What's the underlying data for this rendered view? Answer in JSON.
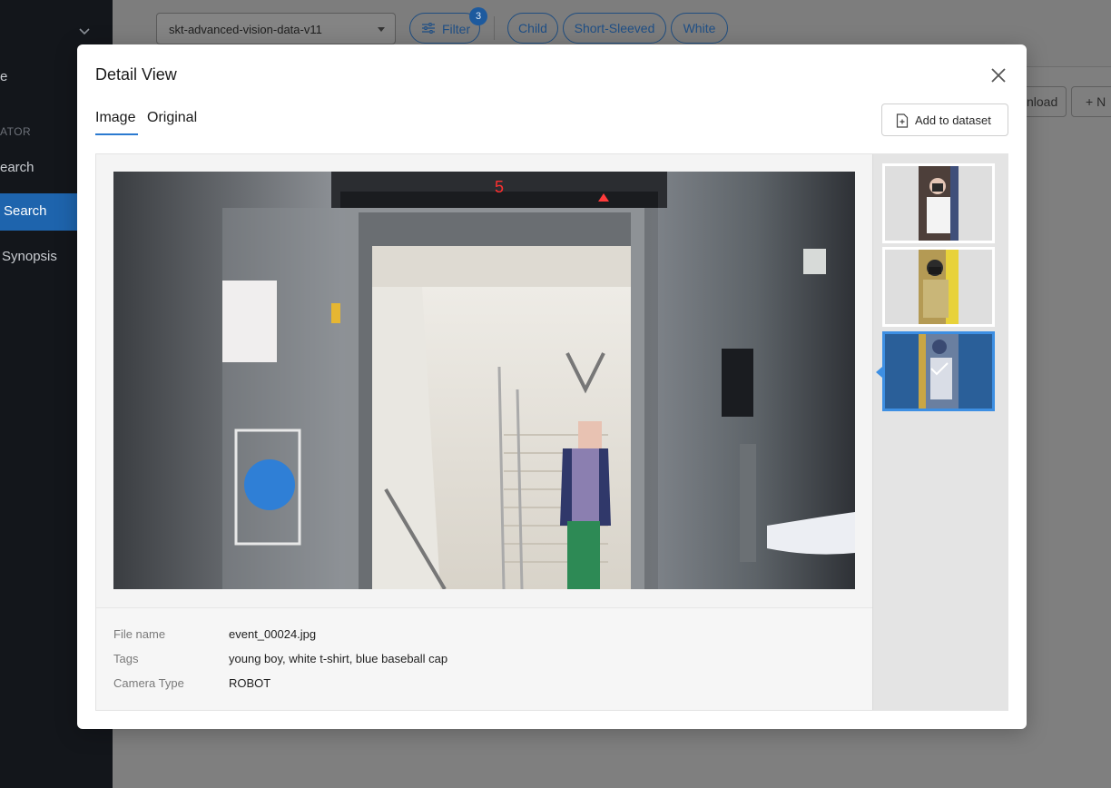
{
  "sidebar": {
    "items": [
      {
        "label": "e"
      },
      {
        "label": "ATOR"
      },
      {
        "label": "earch"
      },
      {
        "label": "Search"
      },
      {
        "label": "Synopsis"
      }
    ]
  },
  "toolbar": {
    "dataset": "skt-advanced-vision-data-v11",
    "filter_label": "Filter",
    "filter_count": "3",
    "chips": [
      "Child",
      "Short-Sleeved",
      "White"
    ],
    "download_label": "nload",
    "new_label": "+ N"
  },
  "modal": {
    "title": "Detail View",
    "tabs": [
      {
        "label": "Image",
        "active": true
      },
      {
        "label": "Original",
        "active": false
      }
    ],
    "add_button": "Add to dataset",
    "image": {
      "floor_indicator": "5"
    },
    "meta": [
      {
        "key": "File name",
        "value": "event_00024.jpg"
      },
      {
        "key": "Tags",
        "value": "young boy, white t-shirt, blue baseball cap"
      },
      {
        "key": "Camera Type",
        "value": "ROBOT"
      }
    ],
    "thumbnails": [
      {
        "selected": false
      },
      {
        "selected": false
      },
      {
        "selected": true
      }
    ]
  },
  "colors": {
    "accent": "#2b7ad0",
    "selected_border": "#3d8fe3",
    "sidebar_active": "#1e64ad"
  }
}
